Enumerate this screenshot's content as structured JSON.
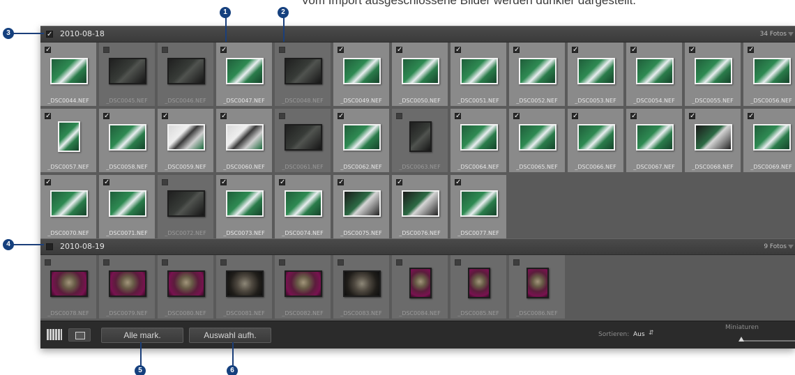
{
  "caption": "Vom Import ausgeschlossene Bilder werden dunkler dargestellt.",
  "colors": {
    "selected_cell": "#8a8a8a",
    "unselected_cell": "#6b6b6b",
    "marker": "#15407e",
    "toolbar": "#2b2b2b"
  },
  "groups": [
    {
      "date": "2010-08-18",
      "count": "34 Fotos",
      "checked": true,
      "photos": [
        {
          "name": "_DSC0044.NEF",
          "checked": true,
          "orient": "l",
          "tone": "g"
        },
        {
          "name": "_DSC0045.NEF",
          "checked": false,
          "orient": "l",
          "tone": "d"
        },
        {
          "name": "_DSC0046.NEF",
          "checked": false,
          "orient": "l",
          "tone": "d"
        },
        {
          "name": "_DSC0047.NEF",
          "checked": true,
          "orient": "l",
          "tone": "g"
        },
        {
          "name": "_DSC0048.NEF",
          "checked": false,
          "orient": "l",
          "tone": "d"
        },
        {
          "name": "_DSC0049.NEF",
          "checked": true,
          "orient": "l",
          "tone": "g"
        },
        {
          "name": "_DSC0050.NEF",
          "checked": true,
          "orient": "l",
          "tone": "g"
        },
        {
          "name": "_DSC0051.NEF",
          "checked": true,
          "orient": "l",
          "tone": "g"
        },
        {
          "name": "_DSC0052.NEF",
          "checked": true,
          "orient": "l",
          "tone": "g"
        },
        {
          "name": "_DSC0053.NEF",
          "checked": true,
          "orient": "l",
          "tone": "g"
        },
        {
          "name": "_DSC0054.NEF",
          "checked": true,
          "orient": "l",
          "tone": "g"
        },
        {
          "name": "_DSC0055.NEF",
          "checked": true,
          "orient": "l",
          "tone": "g"
        },
        {
          "name": "_DSC0056.NEF",
          "checked": true,
          "orient": "l",
          "tone": "g"
        },
        {
          "name": "_DSC0057.NEF",
          "checked": true,
          "orient": "p",
          "tone": "g"
        },
        {
          "name": "_DSC0058.NEF",
          "checked": true,
          "orient": "l",
          "tone": "g"
        },
        {
          "name": "_DSC0059.NEF",
          "checked": true,
          "orient": "l",
          "tone": "w"
        },
        {
          "name": "_DSC0060.NEF",
          "checked": true,
          "orient": "l",
          "tone": "w"
        },
        {
          "name": "_DSC0061.NEF",
          "checked": false,
          "orient": "l",
          "tone": "d"
        },
        {
          "name": "_DSC0062.NEF",
          "checked": true,
          "orient": "l",
          "tone": "g"
        },
        {
          "name": "_DSC0063.NEF",
          "checked": false,
          "orient": "p",
          "tone": "d"
        },
        {
          "name": "_DSC0064.NEF",
          "checked": true,
          "orient": "l",
          "tone": "g"
        },
        {
          "name": "_DSC0065.NEF",
          "checked": true,
          "orient": "l",
          "tone": "g"
        },
        {
          "name": "_DSC0066.NEF",
          "checked": true,
          "orient": "l",
          "tone": "g"
        },
        {
          "name": "_DSC0067.NEF",
          "checked": true,
          "orient": "l",
          "tone": "g"
        },
        {
          "name": "_DSC0068.NEF",
          "checked": true,
          "orient": "l",
          "tone": "k"
        },
        {
          "name": "_DSC0069.NEF",
          "checked": true,
          "orient": "l",
          "tone": "g"
        },
        {
          "name": "_DSC0070.NEF",
          "checked": true,
          "orient": "l",
          "tone": "g"
        },
        {
          "name": "_DSC0071.NEF",
          "checked": true,
          "orient": "l",
          "tone": "g"
        },
        {
          "name": "_DSC0072.NEF",
          "checked": false,
          "orient": "l",
          "tone": "d"
        },
        {
          "name": "_DSC0073.NEF",
          "checked": true,
          "orient": "l",
          "tone": "g"
        },
        {
          "name": "_DSC0074.NEF",
          "checked": true,
          "orient": "l",
          "tone": "g"
        },
        {
          "name": "_DSC0075.NEF",
          "checked": true,
          "orient": "l",
          "tone": "k"
        },
        {
          "name": "_DSC0076.NEF",
          "checked": true,
          "orient": "l",
          "tone": "k"
        },
        {
          "name": "_DSC0077.NEF",
          "checked": true,
          "orient": "l",
          "tone": "g"
        }
      ]
    },
    {
      "date": "2010-08-19",
      "count": "9 Fotos",
      "checked": false,
      "photos": [
        {
          "name": "_DSC0078.NEF",
          "checked": false,
          "orient": "l",
          "tone": "m"
        },
        {
          "name": "_DSC0079.NEF",
          "checked": false,
          "orient": "l",
          "tone": "m"
        },
        {
          "name": "_DSC0080.NEF",
          "checked": false,
          "orient": "l",
          "tone": "m"
        },
        {
          "name": "_DSC0081.NEF",
          "checked": false,
          "orient": "l",
          "tone": "s"
        },
        {
          "name": "_DSC0082.NEF",
          "checked": false,
          "orient": "l",
          "tone": "m"
        },
        {
          "name": "_DSC0083.NEF",
          "checked": false,
          "orient": "l",
          "tone": "s"
        },
        {
          "name": "_DSC0084.NEF",
          "checked": false,
          "orient": "p",
          "tone": "m"
        },
        {
          "name": "_DSC0085.NEF",
          "checked": false,
          "orient": "p",
          "tone": "m"
        },
        {
          "name": "_DSC0086.NEF",
          "checked": false,
          "orient": "p",
          "tone": "m"
        }
      ]
    }
  ],
  "toolbar": {
    "grid_view": "grid-view-icon",
    "loupe_view": "loupe-view-icon",
    "check_all_label": "Alle mark.",
    "uncheck_all_label": "Auswahl aufh.",
    "sort_label": "Sortieren:",
    "sort_value": "Aus",
    "thumbnails_label": "Miniaturen"
  },
  "markers": [
    "1",
    "2",
    "3",
    "4",
    "5",
    "6"
  ]
}
